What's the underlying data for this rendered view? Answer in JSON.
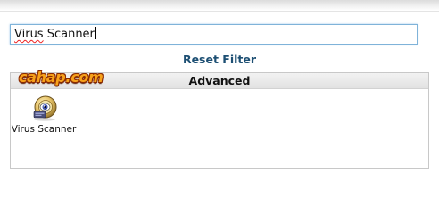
{
  "filter": {
    "value_spell": "Virus",
    "value_rest": " Scanner"
  },
  "reset_filter_label": "Reset Filter",
  "section": {
    "title": "Advanced",
    "watermark": "cahap.com",
    "items": [
      {
        "label": "Virus Scanner",
        "icon": "virus-scanner-icon"
      }
    ]
  }
}
